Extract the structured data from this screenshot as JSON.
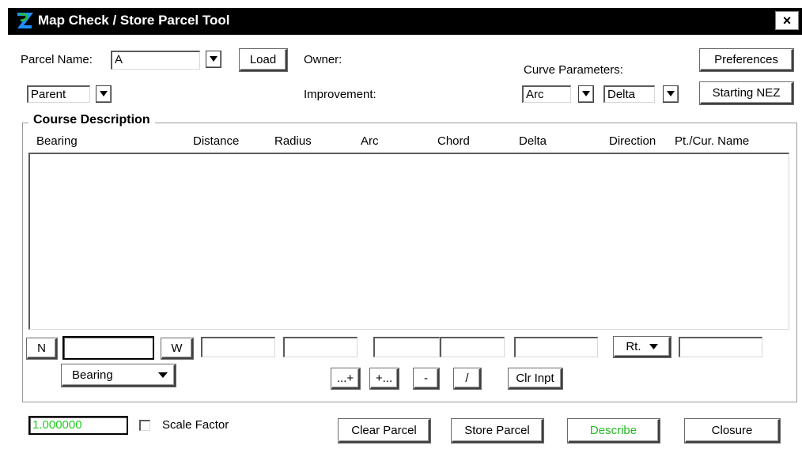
{
  "window": {
    "title": "Map Check / Store Parcel Tool",
    "close": "×"
  },
  "top": {
    "parcel_name_label": "Parcel Name:",
    "parcel_name_value": "A",
    "load": "Load",
    "owner_label": "Owner:",
    "improvement_label": "Improvement:",
    "parent_value": "Parent",
    "curve_parameters_label": "Curve Parameters:",
    "curve_type_value": "Arc",
    "curve_param_value": "Delta",
    "preferences": "Preferences",
    "starting_nez": "Starting NEZ"
  },
  "course": {
    "title": "Course Description",
    "columns": [
      "Bearing",
      "Distance",
      "Radius",
      "Arc",
      "Chord",
      "Delta",
      "Direction",
      "Pt./Cur. Name"
    ]
  },
  "input_row": {
    "n": "N",
    "w": "W",
    "direction_value": "Rt.",
    "bearing_mode_value": "Bearing"
  },
  "ops": {
    "add_after": "...+",
    "add_before": "+...",
    "minus": "-",
    "slash": "/",
    "clear_input": "Clr Inpt"
  },
  "bottom": {
    "scale_value": "1.000000",
    "scale_factor_label": "Scale Factor",
    "clear_parcel": "Clear Parcel",
    "store_parcel": "Store Parcel",
    "describe": "Describe",
    "closure": "Closure"
  },
  "colors": {
    "titlebar": "#000000",
    "scale_value": "#22cc22",
    "describe": "#22bb22"
  },
  "icons": {
    "app": "app-logo-icon",
    "dropdown": "chevron-down-icon",
    "close": "close-icon"
  }
}
